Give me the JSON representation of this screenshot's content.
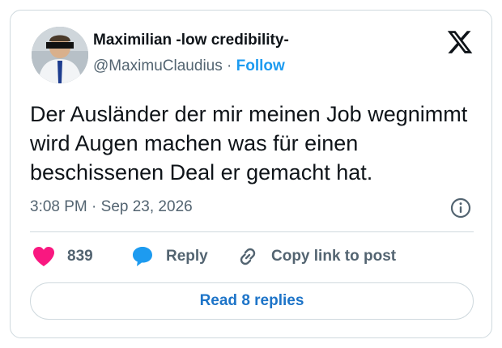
{
  "author": {
    "name": "Maximilian -low credibility-",
    "handle": "@MaximuClaudius",
    "separator": "·",
    "follow_label": "Follow"
  },
  "tweet": {
    "text": "Der Ausländer der mir meinen Job wegnimmt wird Augen machen was für einen beschissenen Deal er gemacht hat.",
    "time": "3:08 PM",
    "date": "Sep 23, 2026",
    "date_separator": "·"
  },
  "actions": {
    "likes": "839",
    "reply_label": "Reply",
    "copy_label": "Copy link to post"
  },
  "footer": {
    "read_replies_label": "Read 8 replies"
  },
  "icons": {
    "brand": "x-logo-icon",
    "like": "heart-icon",
    "reply": "speech-bubble-icon",
    "copy": "link-icon",
    "info": "info-icon"
  },
  "colors": {
    "accent": "#1d9bf0",
    "like": "#f91880",
    "text": "#0f1419",
    "muted": "#536471",
    "border": "#cfd9de"
  }
}
